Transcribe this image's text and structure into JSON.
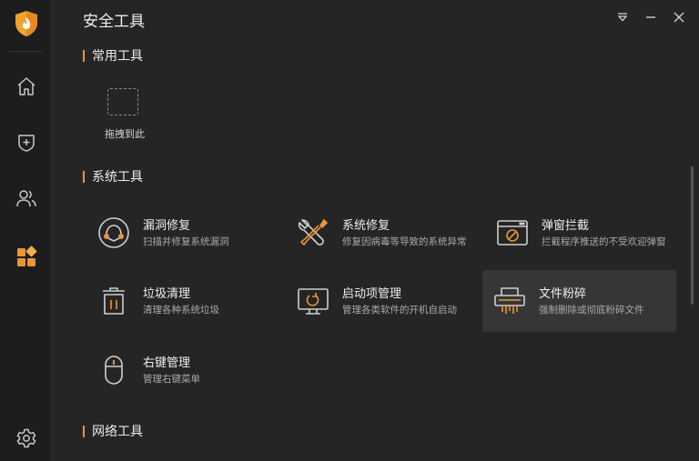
{
  "window": {
    "title": "安全工具",
    "accent_color": "#e8963a"
  },
  "sidebar": {
    "items": [
      {
        "name": "home",
        "icon": "home-icon"
      },
      {
        "name": "protection",
        "icon": "shield-plus-icon"
      },
      {
        "name": "users",
        "icon": "users-icon"
      },
      {
        "name": "tools",
        "icon": "apps-icon",
        "active": true
      },
      {
        "name": "settings",
        "icon": "gear-icon"
      }
    ]
  },
  "sections": {
    "common": {
      "label": "常用工具",
      "drop_label": "拖拽到此"
    },
    "system": {
      "label": "系统工具"
    },
    "network": {
      "label": "网络工具"
    }
  },
  "tools": [
    {
      "name": "漏洞修复",
      "desc": "扫描并修复系统漏洞",
      "icon": "vulnerability-fix-icon"
    },
    {
      "name": "系统修复",
      "desc": "修复因病毒等导致的系统异常",
      "icon": "wrench-screwdriver-icon"
    },
    {
      "name": "弹窗拦截",
      "desc": "拦截程序推送的不受欢迎弹窗",
      "icon": "popup-block-icon"
    },
    {
      "name": "垃圾清理",
      "desc": "清理各种系统垃圾",
      "icon": "trash-icon"
    },
    {
      "name": "启动项管理",
      "desc": "管理各类软件的开机自启动",
      "icon": "startup-monitor-icon"
    },
    {
      "name": "文件粉碎",
      "desc": "强制删除或彻底粉碎文件",
      "icon": "shredder-icon",
      "selected": true
    },
    {
      "name": "右键管理",
      "desc": "管理右键菜单",
      "icon": "mouse-icon"
    }
  ]
}
